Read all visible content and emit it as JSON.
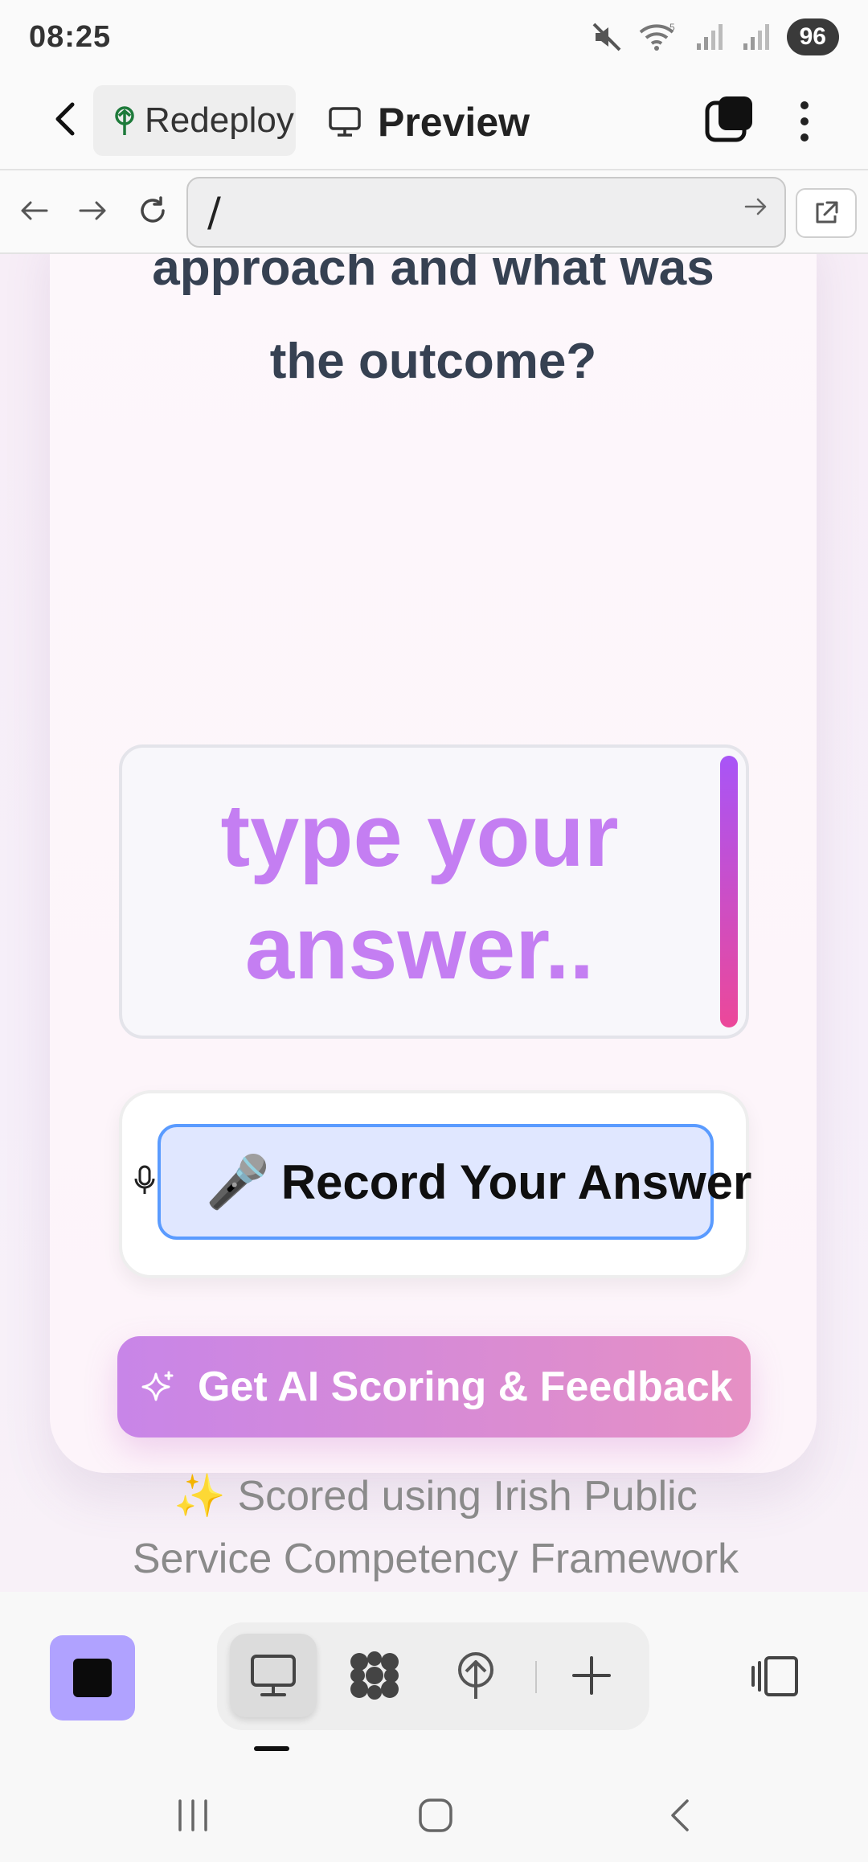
{
  "status_bar": {
    "time": "08:25",
    "battery": "96",
    "icons": [
      "mute-icon",
      "wifi-icon",
      "signal-icon",
      "signal-icon"
    ]
  },
  "header": {
    "project_label": "Redeploy",
    "preview_label": "Preview"
  },
  "url_bar": {
    "path": "/"
  },
  "page": {
    "question_lines": [
      "approach and what was",
      "the outcome?"
    ],
    "answer_placeholder": "type your answer..",
    "record_button": "Record Your Answer",
    "record_emoji": "🎤",
    "score_button": "Get AI Scoring & Feedback",
    "note_sparkle": "✨",
    "note_text": "Scored using Irish Public Service Competency Framework"
  },
  "colors": {
    "placeholder": "#c47ef2",
    "score_gradient_start": "#c885e8",
    "score_gradient_end": "#e690c4",
    "record_bg": "#e0e7ff",
    "record_border": "#5a9bff",
    "stop_button": "#b0a2ff"
  },
  "toolbar": {
    "tools": [
      "desktop-icon",
      "apps-icon",
      "deploy-icon",
      "plus-icon"
    ],
    "active_tool": "desktop-icon"
  }
}
